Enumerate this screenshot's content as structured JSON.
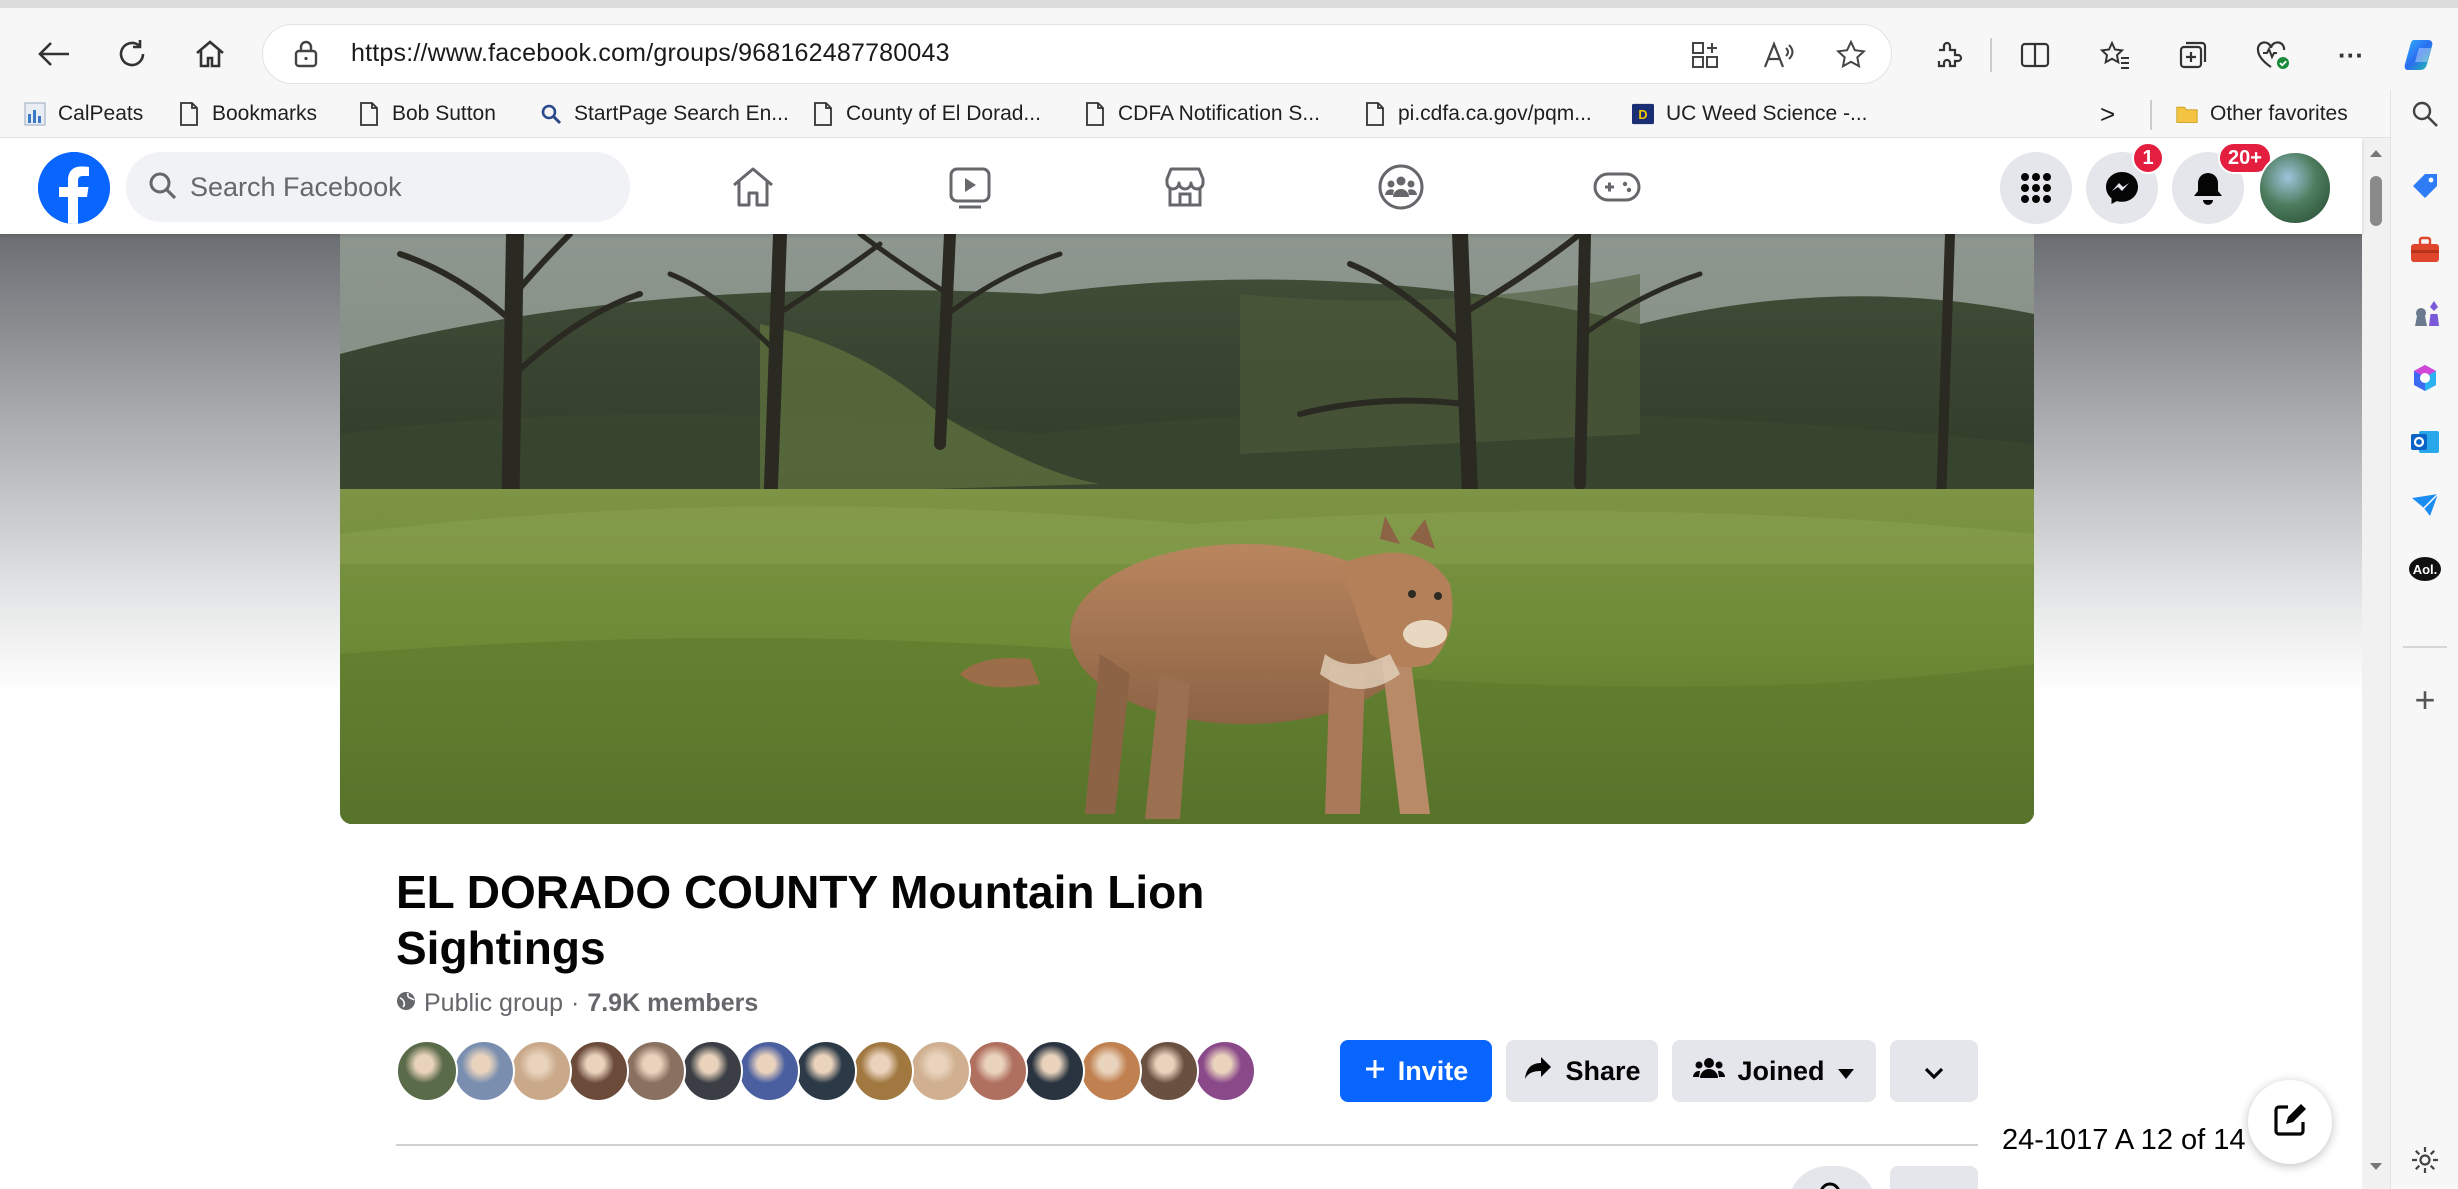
{
  "browser": {
    "url": "https://www.facebook.com/groups/968162487780043",
    "bookmarks": [
      {
        "label": "CalPeats",
        "icon": "bar-chart-icon"
      },
      {
        "label": "Bookmarks",
        "icon": "page-icon"
      },
      {
        "label": "Bob Sutton",
        "icon": "page-icon"
      },
      {
        "label": "StartPage Search En...",
        "icon": "search-icon"
      },
      {
        "label": "County of El Dorad...",
        "icon": "page-icon"
      },
      {
        "label": "CDFA Notification S...",
        "icon": "page-icon"
      },
      {
        "label": "pi.cdfa.ca.gov/pqm...",
        "icon": "page-icon"
      },
      {
        "label": "UC Weed Science -...",
        "icon": "ucd-icon"
      }
    ],
    "bookmarks_overflow": ">",
    "other_favorites": "Other favorites",
    "more_label": "···"
  },
  "facebook": {
    "search_placeholder": "Search Facebook",
    "messenger_badge": "1",
    "notifications_badge": "20+"
  },
  "group": {
    "title": "EL DORADO COUNTY Mountain Lion Sightings",
    "privacy": "Public group",
    "separator": "·",
    "members_count": "7.9K members",
    "invite_label": "Invite",
    "share_label": "Share",
    "joined_label": "Joined",
    "member_avatar_colors": [
      "#5a6b4a",
      "#7a8fb0",
      "#c9a98a",
      "#6b4a3a",
      "#8a7060",
      "#3b3f45",
      "#4a5fa0",
      "#2c3a48",
      "#a07840",
      "#d0b090",
      "#b07060",
      "#2a3440",
      "#c08050",
      "#6a5040",
      "#8a4a8a"
    ]
  },
  "overlay": {
    "page_label": "24-1017 A 12 of 14"
  },
  "colors": {
    "facebook_blue": "#0866ff",
    "badge_red": "#e41e3f"
  }
}
